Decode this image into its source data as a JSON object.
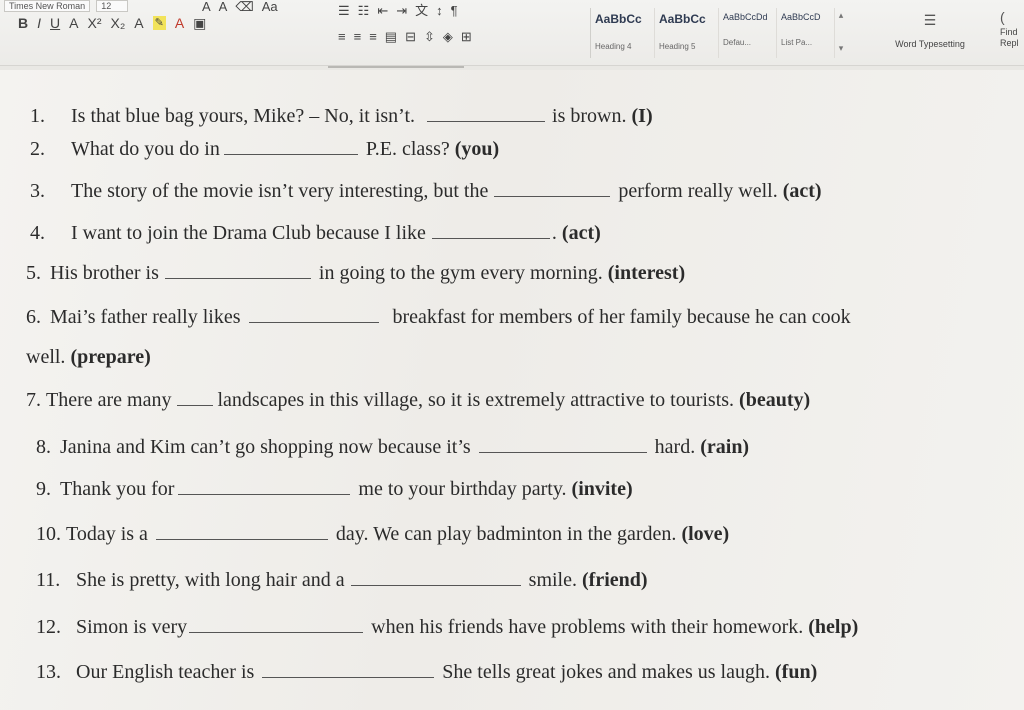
{
  "ribbon": {
    "font_name": "Times New Roman",
    "font_size": "12",
    "styles": [
      {
        "sample": "AaBbCc",
        "name": "Heading 4"
      },
      {
        "sample": "AaBbCc",
        "name": "Heading 5"
      },
      {
        "sample": "AaBbCcDd",
        "name": "Defau..."
      },
      {
        "sample": "AaBbCcD",
        "name": "List Pa..."
      }
    ],
    "word_typesetting": "Word Typesetting",
    "find_label": "Find",
    "replace_label": "Repl"
  },
  "questions": [
    {
      "num": "1.",
      "before": "Is that blue bag yours, Mike? – No, it isn’t.",
      "after": "is brown.",
      "word": "(I)"
    },
    {
      "num": "2.",
      "before": "What do you do in",
      "after": "P.E. class?",
      "word": "(you)"
    },
    {
      "num": "3.",
      "before": "The story of the movie isn’t very interesting, but the",
      "after": "perform really well.",
      "word": "(act)"
    },
    {
      "num": "4.",
      "before": "I want to join the Drama Club because I like",
      "after": ".",
      "word": "(act)"
    },
    {
      "num": "5.",
      "before": "His brother is",
      "after": "in going to the gym every morning.",
      "word": "(interest)"
    },
    {
      "num": "6.",
      "before": "Mai’s father really likes",
      "after": "breakfast for members of her family because he can cook",
      "cont": "well.",
      "word": "(prepare)"
    },
    {
      "num": "7.",
      "before": "There are many",
      "after": "landscapes in this village, so it is extremely attractive to tourists.",
      "word": "(beauty)"
    },
    {
      "num": "8.",
      "before": "Janina and Kim can’t go shopping now because it’s",
      "after": "hard.",
      "word": "(rain)"
    },
    {
      "num": "9.",
      "before": "Thank you for",
      "after": "me to your birthday party.",
      "word": "(invite)"
    },
    {
      "num": "10.",
      "before": "Today is a",
      "after": "day. We can play badminton in the garden.",
      "word": "(love)"
    },
    {
      "num": "11.",
      "before": "She is pretty, with long hair and a",
      "after": "smile.",
      "word": "(friend)"
    },
    {
      "num": "12.",
      "before": "Simon is very",
      "after": "when his friends have problems with their homework.",
      "word": "(help)"
    },
    {
      "num": "13.",
      "before": "Our English teacher is",
      "after": "She tells great jokes and makes us laugh.",
      "word": "(fun)"
    }
  ]
}
